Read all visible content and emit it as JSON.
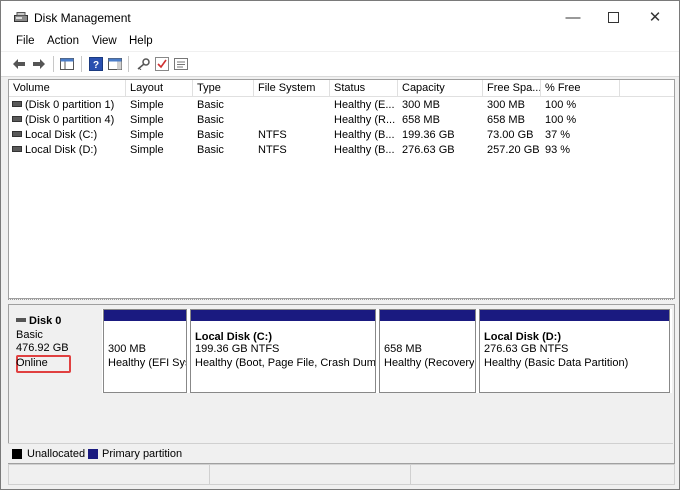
{
  "window": {
    "title": "Disk Management",
    "icon": "disk-management-icon"
  },
  "menu": [
    "File",
    "Action",
    "View",
    "Help"
  ],
  "toolbar": [
    "back-arrow-icon",
    "forward-arrow-icon",
    "console-tree-icon",
    "help-icon",
    "show-pane-icon",
    "key-icon",
    "check-icon",
    "properties-icon"
  ],
  "volumes": {
    "columns": [
      "Volume",
      "Layout",
      "Type",
      "File System",
      "Status",
      "Capacity",
      "Free Spa...",
      "% Free"
    ],
    "rows": [
      [
        "(Disk 0 partition 1)",
        "Simple",
        "Basic",
        "",
        "Healthy (E...",
        "300 MB",
        "300 MB",
        "100 %"
      ],
      [
        "(Disk 0 partition 4)",
        "Simple",
        "Basic",
        "",
        "Healthy (R...",
        "658 MB",
        "658 MB",
        "100 %"
      ],
      [
        "Local Disk (C:)",
        "Simple",
        "Basic",
        "NTFS",
        "Healthy (B...",
        "199.36 GB",
        "73.00 GB",
        "37 %"
      ],
      [
        "Local Disk (D:)",
        "Simple",
        "Basic",
        "NTFS",
        "Healthy (B...",
        "276.63 GB",
        "257.20 GB",
        "93 %"
      ]
    ]
  },
  "disk": {
    "name": "Disk 0",
    "type": "Basic",
    "size": "476.92 GB",
    "status": "Online",
    "partitions": [
      {
        "name": "",
        "size": "300 MB",
        "status": "Healthy (EFI Sys"
      },
      {
        "name": "Local Disk  (C:)",
        "size": "199.36 GB NTFS",
        "status": "Healthy (Boot, Page File, Crash Dump"
      },
      {
        "name": "",
        "size": "658 MB",
        "status": "Healthy (Recovery"
      },
      {
        "name": "Local Disk  (D:)",
        "size": "276.63 GB NTFS",
        "status": "Healthy (Basic Data Partition)"
      }
    ]
  },
  "legend": [
    {
      "label": "Unallocated",
      "color": "#000000"
    },
    {
      "label": "Primary partition",
      "color": "#1a1a80"
    }
  ],
  "colors": {
    "primary_partition": "#1a1a80",
    "highlight": "#e04040"
  }
}
